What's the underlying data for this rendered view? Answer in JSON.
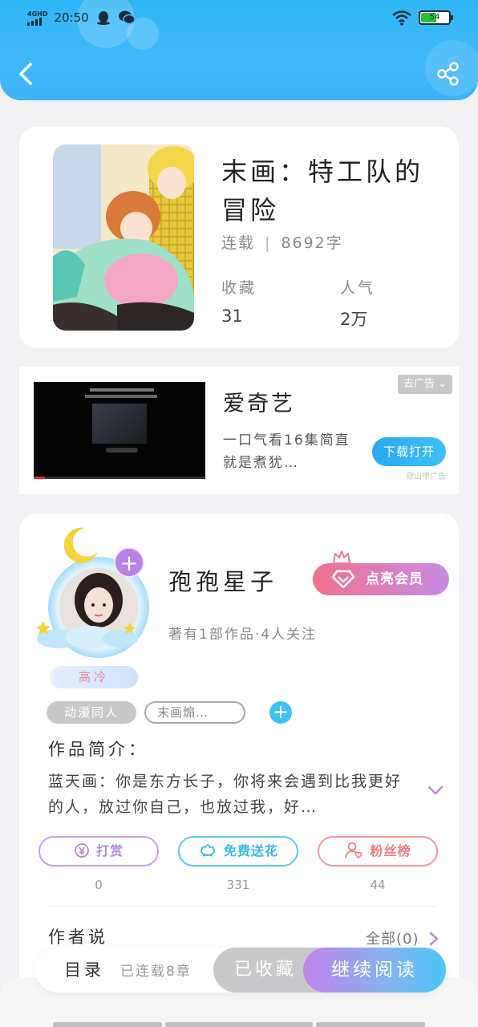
{
  "status_bar": {
    "network": "4GHD",
    "time": "20:50",
    "battery": "54"
  },
  "book": {
    "title": "末画：特工队的冒险",
    "status": "连载",
    "chapters": "8692字",
    "stats": [
      {
        "label": "收藏",
        "value": "31"
      },
      {
        "label": "人气",
        "value": "2万"
      }
    ]
  },
  "ad": {
    "title": "爱奇艺",
    "description": "一口气看16集简直就是煮犹…",
    "tag": "去广告",
    "cta": "下载打开",
    "source": "穿山甲广告"
  },
  "author": {
    "name": "孢孢星子",
    "level_badge": "高冷",
    "vip_label": "点亮会员",
    "subtitle": "著有1部作品·4人关注",
    "tags": [
      "动漫同人",
      "末画煽…"
    ],
    "intro_label": "作品简介：",
    "intro_text": "蓝天画：你是东方长子，你将来会遇到比我更好的人，放过你自己，也放过我，好…",
    "actions": [
      {
        "label": "打赏",
        "count": "0",
        "color": "#b388e0"
      },
      {
        "label": "免费送花",
        "count": "331",
        "color": "#3bb8e8"
      },
      {
        "label": "粉丝榜",
        "count": "44",
        "color": "#ee7d7d"
      }
    ],
    "author_says_label": "作者说",
    "all_link": "全部(0)"
  },
  "bottom_bar": {
    "toc_label": "目录",
    "toc_sub": "已连载8章",
    "collected_label": "已收藏",
    "continue_label": "继续阅读"
  },
  "icons": {
    "back": "back-arrow-icon",
    "share": "share-icon",
    "diamond": "diamond-icon",
    "chevron": "chevron-down-icon"
  }
}
